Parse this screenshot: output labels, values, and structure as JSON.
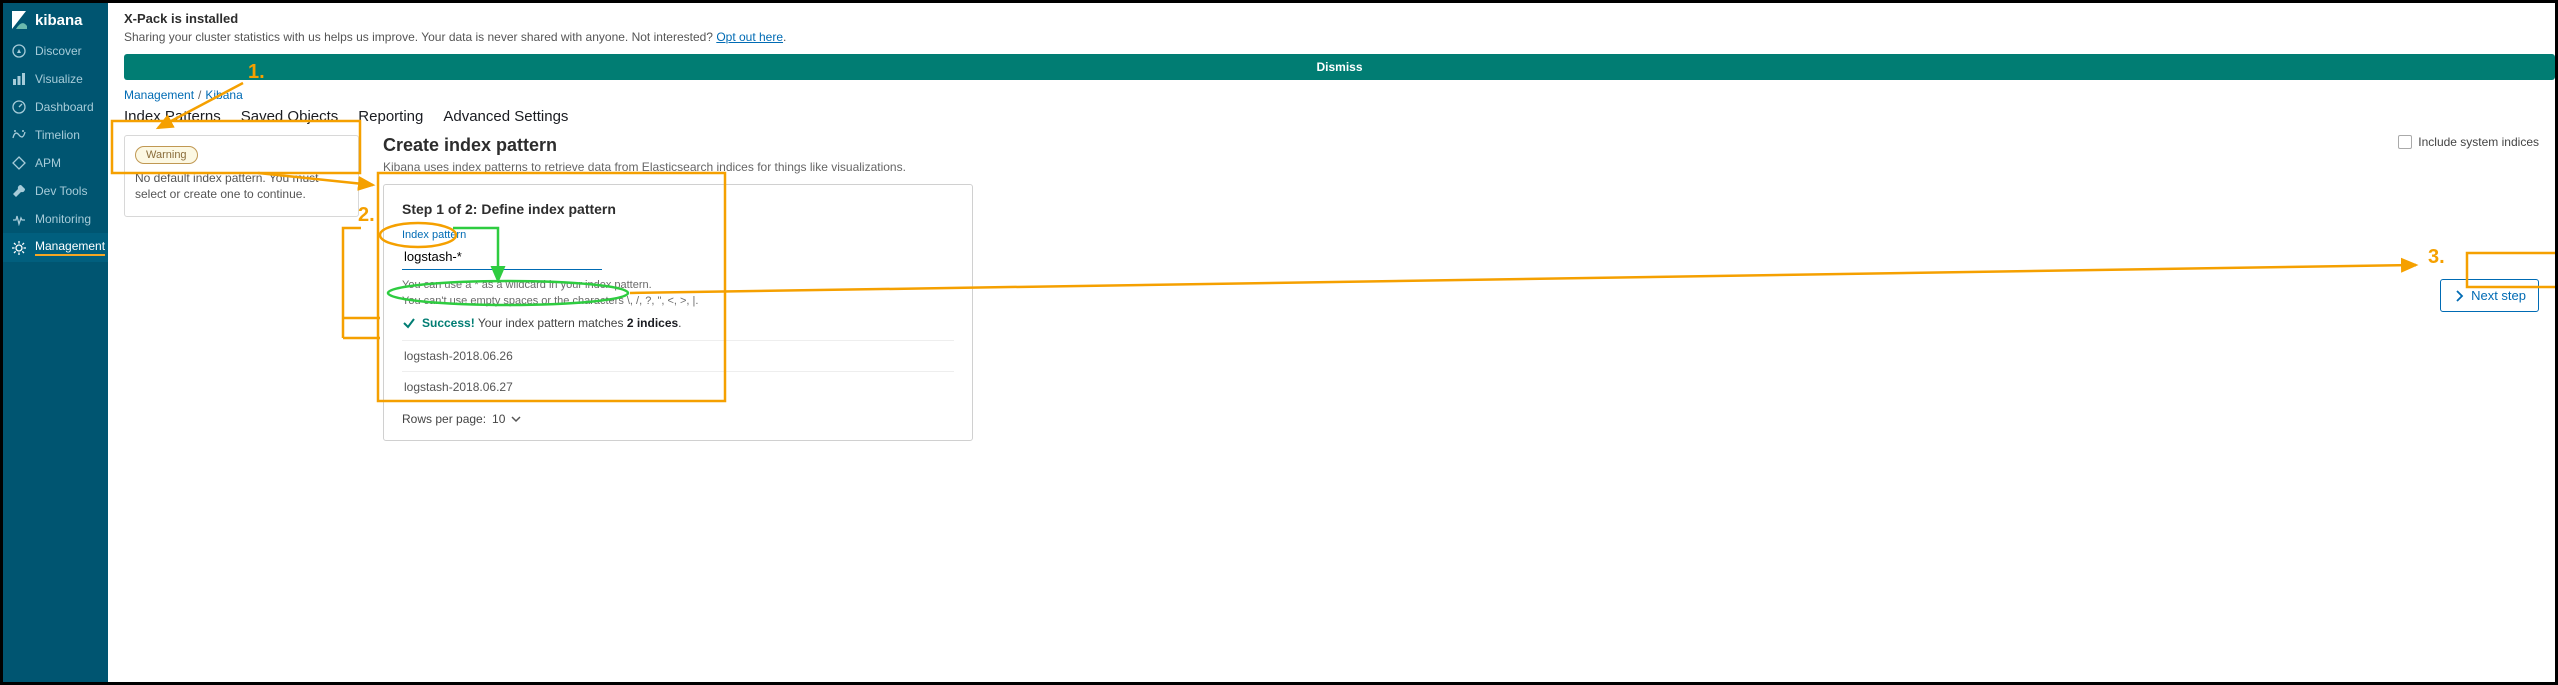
{
  "app_name": "kibana",
  "sidebar": {
    "items": [
      {
        "id": "discover",
        "label": "Discover"
      },
      {
        "id": "visualize",
        "label": "Visualize"
      },
      {
        "id": "dashboard",
        "label": "Dashboard"
      },
      {
        "id": "timelion",
        "label": "Timelion"
      },
      {
        "id": "apm",
        "label": "APM"
      },
      {
        "id": "devtools",
        "label": "Dev Tools"
      },
      {
        "id": "monitoring",
        "label": "Monitoring"
      },
      {
        "id": "management",
        "label": "Management"
      }
    ],
    "active": "management"
  },
  "banner": {
    "title": "X-Pack is installed",
    "text": "Sharing your cluster statistics with us helps us improve. Your data is never shared with anyone. Not interested? ",
    "link": "Opt out here",
    "dismiss": "Dismiss"
  },
  "crumbs": {
    "a": "Management",
    "b": "Kibana"
  },
  "tabs": [
    "Index Patterns",
    "Saved Objects",
    "Reporting",
    "Advanced Settings"
  ],
  "warning": {
    "pill": "Warning",
    "msg": "No default index pattern. You must select or create one to continue."
  },
  "page": {
    "title": "Create index pattern",
    "subtitle": "Kibana uses index patterns to retrieve data from Elasticsearch indices for things like visualizations.",
    "toggle": "Include system indices"
  },
  "step": {
    "heading": "Step 1 of 2: Define index pattern",
    "label": "Index pattern",
    "value": "logstash-*",
    "hint1": "You can use a * as a wildcard in your index pattern.",
    "hint2": "You can't use empty spaces or the characters \\, /, ?, \", <, >, |.",
    "success_strong": "Success!",
    "success_mid": " Your index pattern matches ",
    "success_count": "2 indices",
    "matches": [
      "logstash-2018.06.26",
      "logstash-2018.06.27"
    ],
    "pager_prefix": "Rows per page: ",
    "pager_value": "10"
  },
  "next": "Next step",
  "annotations": {
    "one": "1.",
    "two": "2.",
    "three": "3."
  }
}
